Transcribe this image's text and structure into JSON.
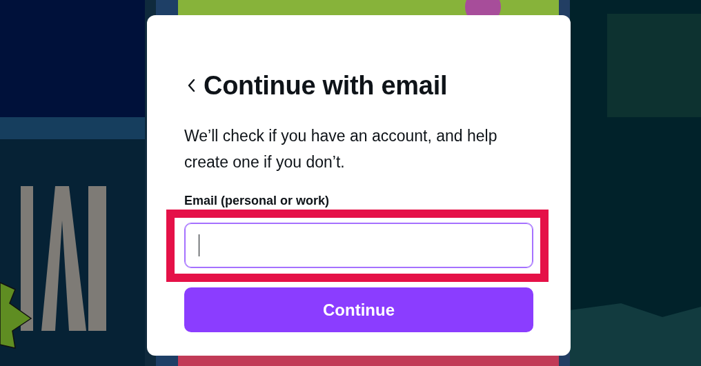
{
  "dialog": {
    "title": "Continue with email",
    "description": "We’ll check if you have an account, and help create one if you don’t.",
    "email_field": {
      "label": "Email (personal or work)",
      "focused": true,
      "highlighted": true
    },
    "continue_button": {
      "label": "Continue"
    }
  }
}
